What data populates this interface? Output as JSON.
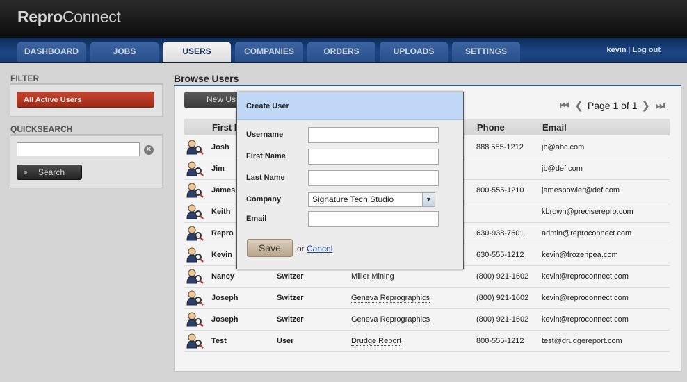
{
  "app": {
    "logo_bold": "Repro",
    "logo_light": "Connect"
  },
  "nav": {
    "tabs": [
      "DASHBOARD",
      "JOBS",
      "USERS",
      "COMPANIES",
      "ORDERS",
      "UPLOADS",
      "SETTINGS"
    ],
    "active": "USERS",
    "user": "kevin",
    "separator": "|",
    "logout": "Log out"
  },
  "sidebar": {
    "filter_heading": "FILTER",
    "filter_button": "All Active Users",
    "quicksearch_heading": "QUICKSEARCH",
    "search_value": "",
    "search_button": "Search"
  },
  "main": {
    "title": "Browse Users",
    "new_button": "New Us",
    "pager": {
      "text": "Page 1 of 1"
    },
    "columns": [
      "First N",
      "Phone",
      "Email"
    ],
    "rows": [
      {
        "first": "Josh",
        "last": "",
        "company": "",
        "phone": "888 555-1212",
        "email": "jb@abc.com"
      },
      {
        "first": "Jim",
        "last": "",
        "company": "",
        "phone": "",
        "email": "jb@def.com"
      },
      {
        "first": "James",
        "last": "",
        "company": "",
        "phone": "800-555-1210",
        "email": "jamesbowler@def.com"
      },
      {
        "first": "Keith",
        "last": "",
        "company": "",
        "phone": "",
        "email": "kbrown@preciserepro.com"
      },
      {
        "first": "Repro",
        "last": "",
        "company": "",
        "phone": "630-938-7601",
        "email": "admin@reproconnect.com"
      },
      {
        "first": "Kevin",
        "last": "",
        "company": "",
        "phone": "630-555-1212",
        "email": "kevin@frozenpea.com"
      },
      {
        "first": "Nancy",
        "last": "Switzer",
        "company": "Miller Mining",
        "phone": "(800) 921-1602",
        "email": "kevin@reproconnect.com"
      },
      {
        "first": "Joseph",
        "last": "Switzer",
        "company": "Geneva Reprographics",
        "phone": "(800) 921-1602",
        "email": "kevin@reproconnect.com"
      },
      {
        "first": "Joseph",
        "last": "Switzer",
        "company": "Geneva Reprographics",
        "phone": "(800) 921-1602",
        "email": "kevin@reproconnect.com"
      },
      {
        "first": "Test",
        "last": "User",
        "company": "Drudge Report",
        "phone": "800-555-1212",
        "email": "test@drudgereport.com"
      }
    ]
  },
  "dialog": {
    "title": "Create User",
    "labels": {
      "username": "Username",
      "first_name": "First Name",
      "last_name": "Last Name",
      "company": "Company",
      "email": "Email"
    },
    "values": {
      "username": "",
      "first_name": "",
      "last_name": "",
      "company": "Signature Tech Studio",
      "email": ""
    },
    "save": "Save",
    "or": "or",
    "cancel": "Cancel"
  }
}
